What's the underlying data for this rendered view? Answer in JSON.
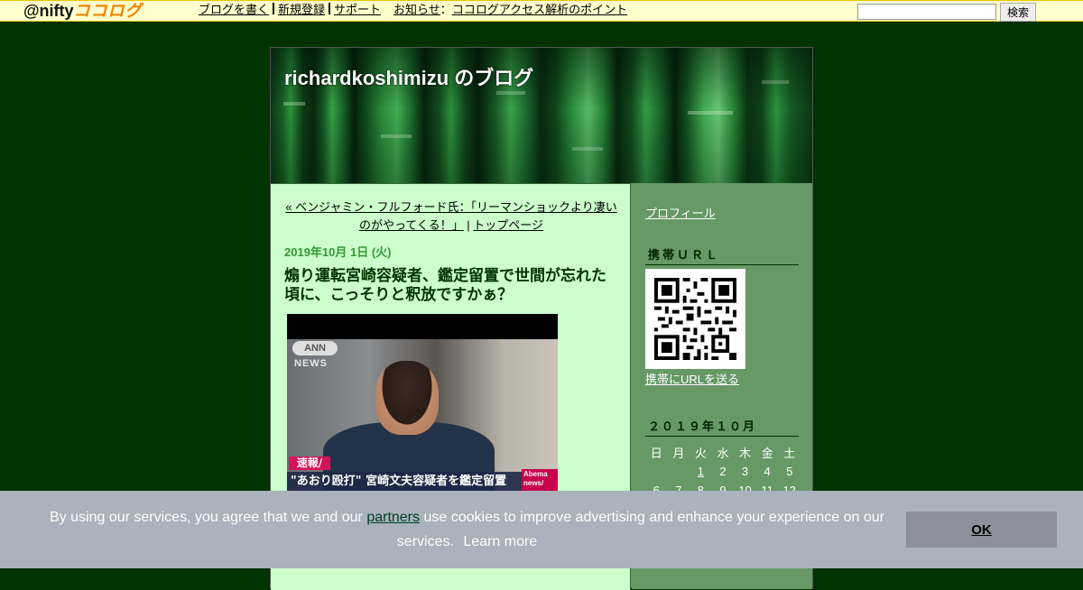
{
  "topbar": {
    "logo_prefix": "@nifty",
    "logo_brand": "ココログ",
    "nav": {
      "write": "ブログを書く",
      "register": "新規登録",
      "support": "サポート",
      "news_label": "お知らせ",
      "news_colon": "：",
      "news_link": "ココログアクセス解析のポイント"
    },
    "search_value": "",
    "search_button": "検索"
  },
  "blog": {
    "title": "richardkoshimizu のブログ"
  },
  "entry": {
    "prev_link": "« ベンジャミン・フルフォード氏：「リーマンショックより凄いのがやってくる！」",
    "nav_sep": "|",
    "top_link": "トップページ",
    "date": "2019年10月 1日 (火)",
    "title": "煽り運転宮崎容疑者、鑑定留置で世間が忘れた頃に、こっそりと釈放ですかぁ？",
    "image": {
      "ann": "ANN",
      "news": "NEWS",
      "flash": "速報/",
      "caption": "\"あおり殴打\" 宮崎文夫容疑者を鑑定留置",
      "abema": "Abema news/"
    }
  },
  "sidebar": {
    "profile_link": "プロフィール",
    "mobile_heading": "携帯ＵＲＬ",
    "qr_link": "携帯にURLを送る",
    "calendar_heading": "２０１９年１０月",
    "calendar": {
      "weekdays": [
        "日",
        "月",
        "火",
        "水",
        "木",
        "金",
        "土"
      ],
      "row1": [
        "",
        "",
        "1",
        "2",
        "3",
        "4",
        "5"
      ],
      "row2": [
        "6",
        "7",
        "8",
        "9",
        "10",
        "11",
        "12"
      ]
    }
  },
  "cookie": {
    "text_before": "By using our services, you agree that we and our",
    "partners_link": "partners",
    "text_after": "use cookies to improve advertising and enhance your experience on our services.",
    "learn_more": "Learn more",
    "ok_button": "OK"
  },
  "colors": {
    "page_bg": "#003300",
    "topbar_bg": "#ffffcc",
    "content_bg": "#ccffcc",
    "sidebar_bg": "#669966",
    "date_green": "#339933",
    "cookie_bg": "#a9b2bd"
  }
}
